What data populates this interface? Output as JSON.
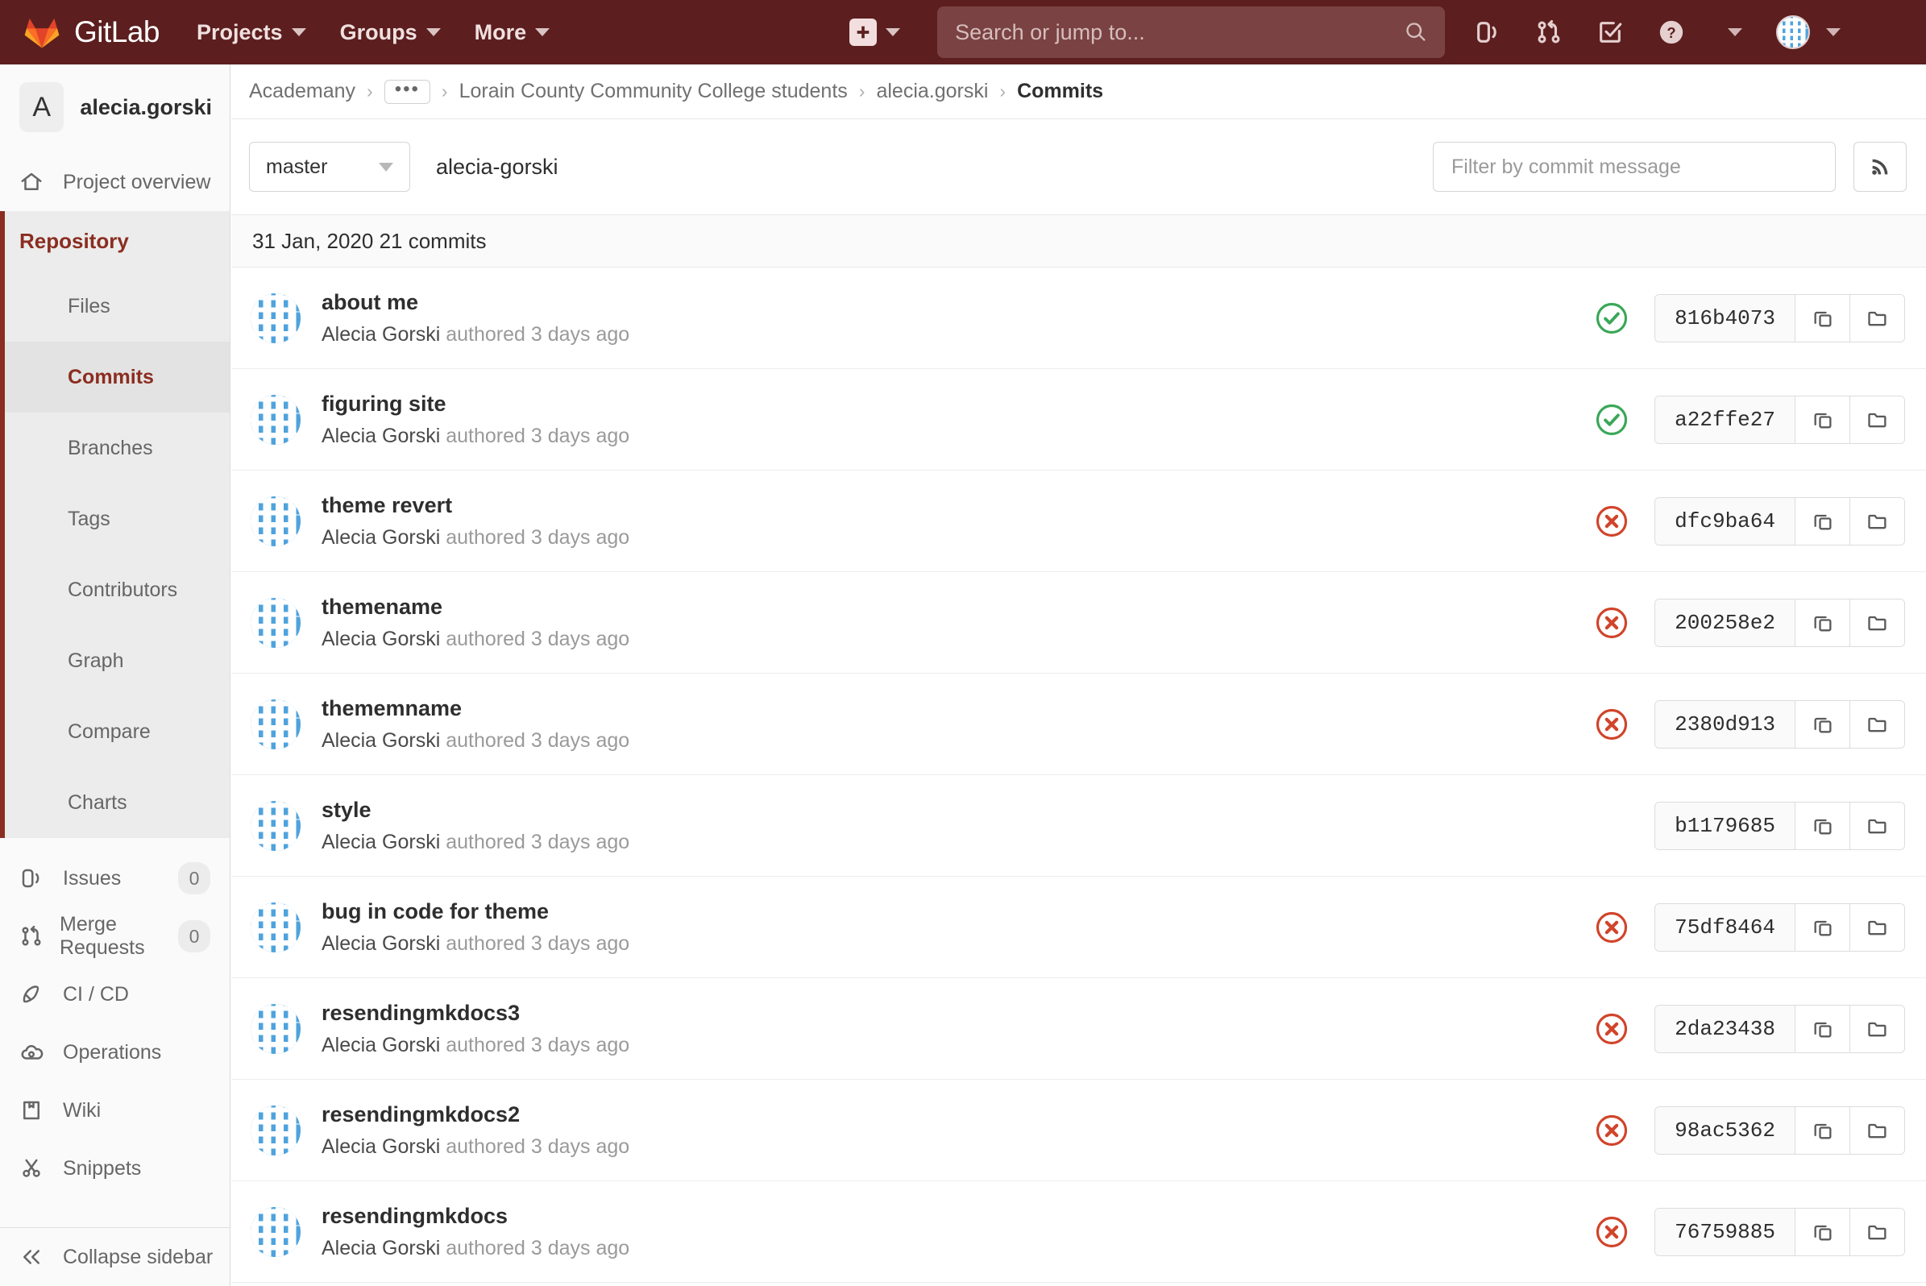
{
  "topnav": {
    "brand": "GitLab",
    "items": [
      {
        "label": "Projects",
        "name": "nav-projects"
      },
      {
        "label": "Groups",
        "name": "nav-groups"
      },
      {
        "label": "More",
        "name": "nav-more"
      }
    ],
    "new_button_icon": "plus-square-icon",
    "search_placeholder": "Search or jump to...",
    "icons": [
      {
        "name": "issues-icon"
      },
      {
        "name": "merge-requests-icon"
      },
      {
        "name": "todos-icon"
      },
      {
        "name": "help-icon"
      },
      {
        "name": "user-avatar"
      }
    ],
    "brand_color": "#5c1e1e"
  },
  "sidebar": {
    "project_initial": "A",
    "project_name": "alecia.gorski",
    "overview_label": "Project overview",
    "repository_label": "Repository",
    "repo_subitems": [
      {
        "label": "Files"
      },
      {
        "label": "Commits"
      },
      {
        "label": "Branches"
      },
      {
        "label": "Tags"
      },
      {
        "label": "Contributors"
      },
      {
        "label": "Graph"
      },
      {
        "label": "Compare"
      },
      {
        "label": "Charts"
      }
    ],
    "active_subitem": "Commits",
    "items": [
      {
        "label": "Issues",
        "badge": "0",
        "icon": "issues-icon"
      },
      {
        "label": "Merge Requests",
        "badge": "0",
        "icon": "merge-requests-icon"
      },
      {
        "label": "CI / CD",
        "badge": "",
        "icon": "rocket-icon"
      },
      {
        "label": "Operations",
        "badge": "",
        "icon": "cloud-gear-icon"
      },
      {
        "label": "Wiki",
        "badge": "",
        "icon": "book-icon"
      },
      {
        "label": "Snippets",
        "badge": "",
        "icon": "scissors-icon"
      }
    ],
    "collapse_label": "Collapse sidebar",
    "active_color": "#8b2d20"
  },
  "breadcrumb": {
    "items": [
      {
        "label": "Academany",
        "current": false
      },
      {
        "label": "•••",
        "current": false
      },
      {
        "label": "Lorain County Community College students",
        "current": false
      },
      {
        "label": "alecia.gorski",
        "current": false
      },
      {
        "label": "Commits",
        "current": true
      }
    ]
  },
  "toolbar": {
    "branch": "master",
    "repo_label": "alecia-gorski",
    "filter_placeholder": "Filter by commit message",
    "rss_icon": "rss-feed-icon"
  },
  "commits": {
    "day_header": "31 Jan, 2020 21 commits",
    "rows": [
      {
        "title": "about me",
        "author": "Alecia Gorski",
        "meta": "authored 3 days ago",
        "sha": "816b4073",
        "status": "passed"
      },
      {
        "title": "figuring site",
        "author": "Alecia Gorski",
        "meta": "authored 3 days ago",
        "sha": "a22ffe27",
        "status": "passed"
      },
      {
        "title": "theme revert",
        "author": "Alecia Gorski",
        "meta": "authored 3 days ago",
        "sha": "dfc9ba64",
        "status": "failed"
      },
      {
        "title": "themename",
        "author": "Alecia Gorski",
        "meta": "authored 3 days ago",
        "sha": "200258e2",
        "status": "failed"
      },
      {
        "title": "thememname",
        "author": "Alecia Gorski",
        "meta": "authored 3 days ago",
        "sha": "2380d913",
        "status": "failed"
      },
      {
        "title": "style",
        "author": "Alecia Gorski",
        "meta": "authored 3 days ago",
        "sha": "b1179685",
        "status": "none"
      },
      {
        "title": "bug in code for theme",
        "author": "Alecia Gorski",
        "meta": "authored 3 days ago",
        "sha": "75df8464",
        "status": "failed"
      },
      {
        "title": "resendingmkdocs3",
        "author": "Alecia Gorski",
        "meta": "authored 3 days ago",
        "sha": "2da23438",
        "status": "failed"
      },
      {
        "title": "resendingmkdocs2",
        "author": "Alecia Gorski",
        "meta": "authored 3 days ago",
        "sha": "98ac5362",
        "status": "failed"
      },
      {
        "title": "resendingmkdocs",
        "author": "Alecia Gorski",
        "meta": "authored 3 days ago",
        "sha": "76759885",
        "status": "failed"
      }
    ],
    "copy_icon": "copy-icon",
    "browse_icon": "folder-open-icon",
    "status_passed_color": "#3aa757",
    "status_failed_color": "#d1442a"
  }
}
